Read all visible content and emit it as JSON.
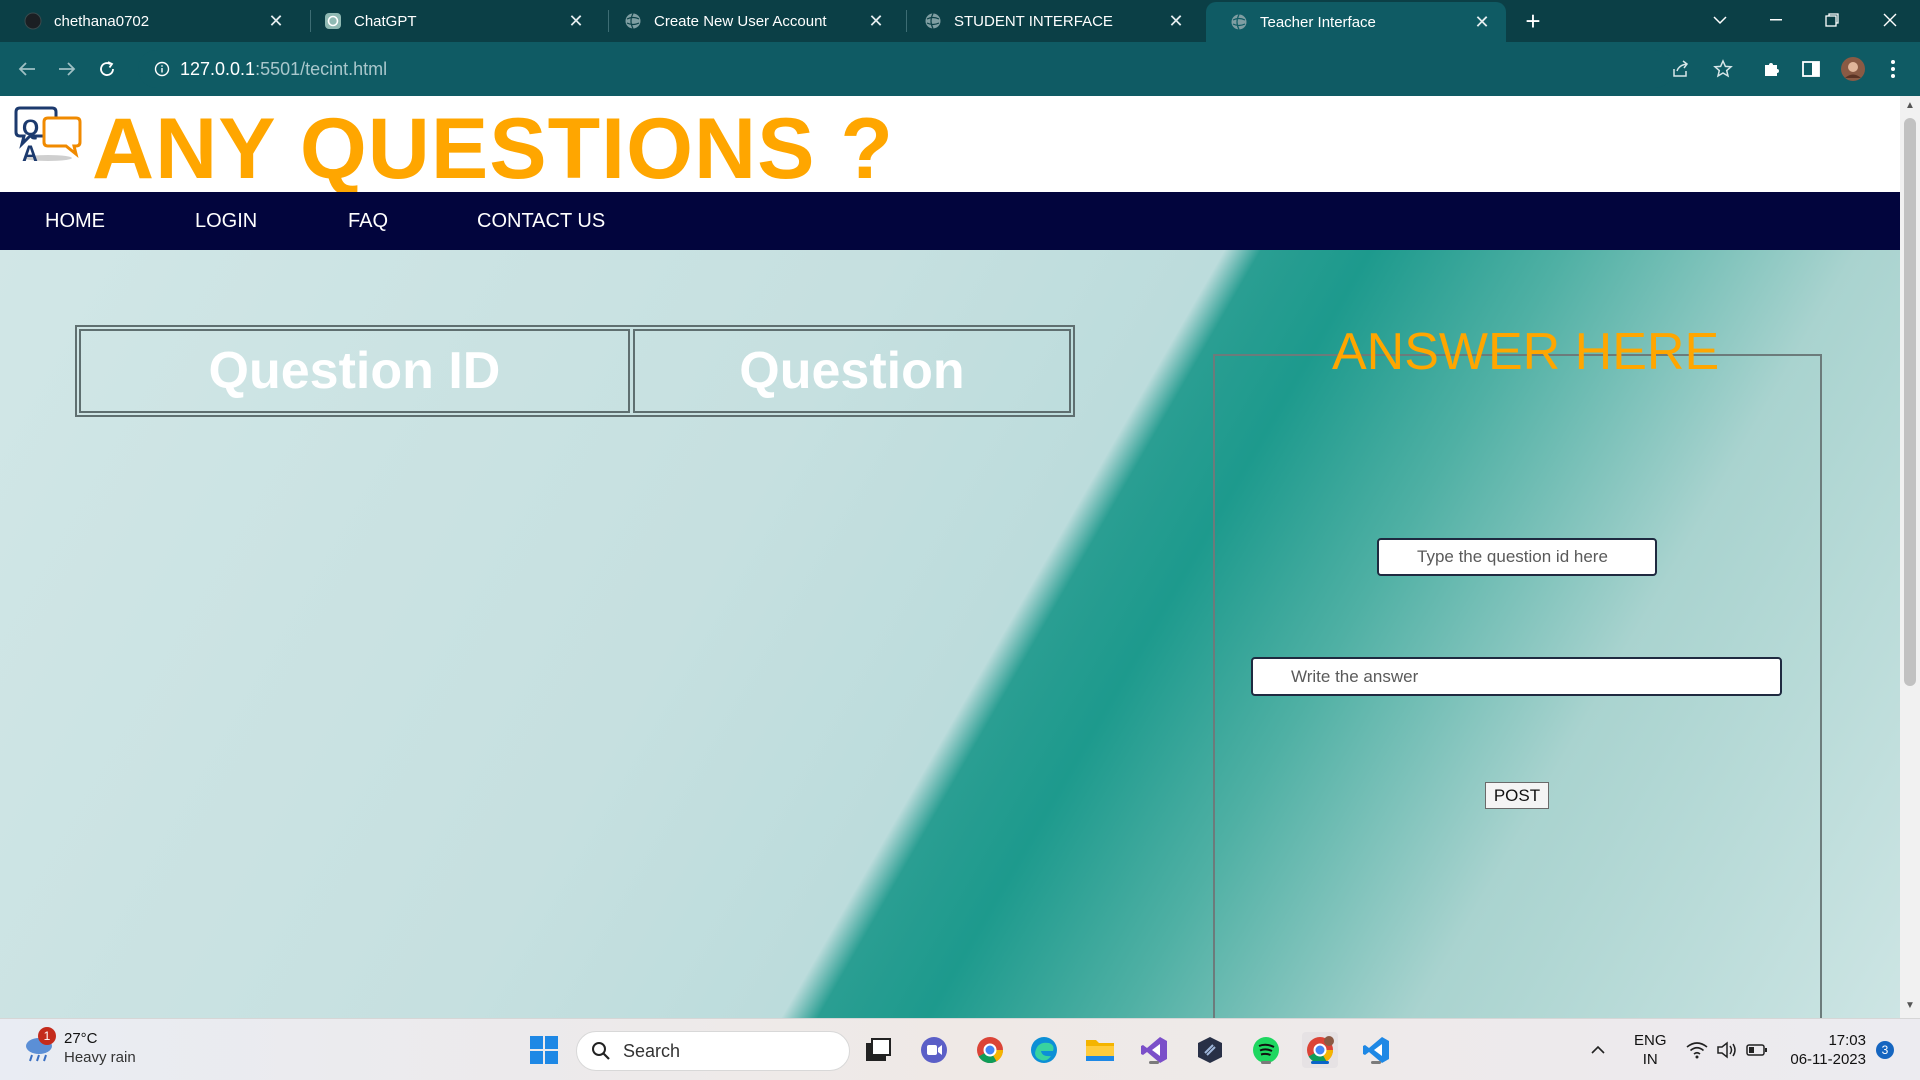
{
  "browser": {
    "tabs": [
      {
        "title": "chethana0702",
        "icon": "github-icon",
        "active": false
      },
      {
        "title": "ChatGPT",
        "icon": "chatgpt-icon",
        "active": false
      },
      {
        "title": "Create New User Account",
        "icon": "globe-icon",
        "active": false
      },
      {
        "title": "STUDENT INTERFACE",
        "icon": "globe-icon",
        "active": false
      },
      {
        "title": "Teacher Interface",
        "icon": "globe-icon",
        "active": true
      }
    ],
    "address_host": "127.0.0.1",
    "address_rest": ":5501/tecint.html"
  },
  "site": {
    "logo_text": "Q A",
    "title": "ANY QUESTIONS ?",
    "nav": {
      "home": "HOME",
      "login": "LOGIN",
      "faq": "FAQ",
      "contact": "CONTACT US"
    }
  },
  "questions_table": {
    "col_id": "Question ID",
    "col_question": "Question"
  },
  "answer_form": {
    "title": "ANSWER HERE",
    "qid_placeholder": "Type the question id here",
    "answer_placeholder": "Write the answer",
    "post_label": "POST"
  },
  "taskbar": {
    "weather_temp": "27°C",
    "weather_cond": "Heavy rain",
    "weather_badge": "1",
    "search_label": "Search",
    "lang_top": "ENG",
    "lang_bottom": "IN",
    "time": "17:03",
    "date": "06-11-2023",
    "notification_count": "3"
  },
  "colors": {
    "accent": "#ffa600",
    "navbar": "#02053d",
    "browser_frame": "#0f5b64"
  }
}
